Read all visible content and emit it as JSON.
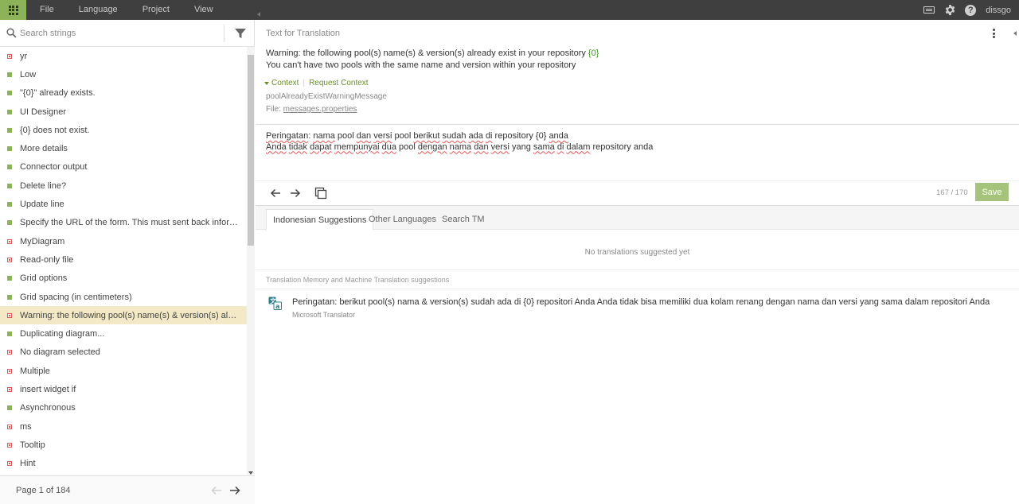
{
  "topbar": {
    "menu": [
      "File",
      "Language",
      "Project",
      "View"
    ],
    "user": "dissgo"
  },
  "search": {
    "placeholder": "Search strings"
  },
  "list": [
    {
      "text": "yr",
      "status": "red"
    },
    {
      "text": "Low",
      "status": "green"
    },
    {
      "text": "\"{0}\" already exists.",
      "status": "green"
    },
    {
      "text": "UI Designer",
      "status": "green"
    },
    {
      "text": "{0} does not exist.",
      "status": "green"
    },
    {
      "text": "More details",
      "status": "green"
    },
    {
      "text": "Connector output",
      "status": "green"
    },
    {
      "text": "Delete line?",
      "status": "green"
    },
    {
      "text": "Update line",
      "status": "green"
    },
    {
      "text": "Specify the URL of the form. This must sent back information that ...",
      "status": "green"
    },
    {
      "text": "MyDiagram",
      "status": "red"
    },
    {
      "text": "Read-only file",
      "status": "red"
    },
    {
      "text": "Grid options",
      "status": "green"
    },
    {
      "text": "Grid spacing (in centimeters)",
      "status": "green"
    },
    {
      "text": "Warning: the following pool(s) name(s) & version(s) already exist in...",
      "status": "red",
      "selected": true
    },
    {
      "text": "Duplicating diagram...",
      "status": "green"
    },
    {
      "text": "No diagram selected",
      "status": "red"
    },
    {
      "text": "Multiple",
      "status": "red"
    },
    {
      "text": "insert widget if",
      "status": "red"
    },
    {
      "text": "Asynchronous",
      "status": "green"
    },
    {
      "text": "ms",
      "status": "red"
    },
    {
      "text": "Tooltip",
      "status": "red"
    },
    {
      "text": "Hint",
      "status": "red"
    }
  ],
  "pager": {
    "label": "Page 1 of 184"
  },
  "source": {
    "header": "Text for Translation",
    "line1_prefix": "Warning: the following pool(s) name(s) & version(s) already exist in your repository ",
    "line1_placeholder": "{0}",
    "line2": "You can't have two pools with the same name and version within your repository"
  },
  "context": {
    "toggle": "Context",
    "request": "Request Context",
    "key": "poolAlreadyExistWarningMessage",
    "file_label": "File: ",
    "file_name": "messages.properties"
  },
  "target": {
    "line1": [
      {
        "t": "Peringatan",
        "sp": true
      },
      {
        "t": ": ",
        "sp": false
      },
      {
        "t": "nama",
        "sp": true
      },
      {
        "t": " pool ",
        "sp": false
      },
      {
        "t": "dan",
        "sp": true
      },
      {
        "t": " ",
        "sp": false
      },
      {
        "t": "versi",
        "sp": true
      },
      {
        "t": " pool ",
        "sp": false
      },
      {
        "t": "berikut",
        "sp": true
      },
      {
        "t": " ",
        "sp": false
      },
      {
        "t": "sudah",
        "sp": true
      },
      {
        "t": " ",
        "sp": false
      },
      {
        "t": "ada",
        "sp": true
      },
      {
        "t": " ",
        "sp": false
      },
      {
        "t": "di",
        "sp": true
      },
      {
        "t": " repository {0} ",
        "sp": false
      },
      {
        "t": "anda",
        "sp": true
      }
    ],
    "line2": [
      {
        "t": "Anda",
        "sp": true
      },
      {
        "t": " ",
        "sp": false
      },
      {
        "t": "tidak",
        "sp": true
      },
      {
        "t": " ",
        "sp": false
      },
      {
        "t": "dapat",
        "sp": true
      },
      {
        "t": " ",
        "sp": false
      },
      {
        "t": "mempunyai",
        "sp": true
      },
      {
        "t": " ",
        "sp": false
      },
      {
        "t": "dua",
        "sp": true
      },
      {
        "t": " pool ",
        "sp": false
      },
      {
        "t": "dengan",
        "sp": true
      },
      {
        "t": " ",
        "sp": false
      },
      {
        "t": "nama",
        "sp": true
      },
      {
        "t": " ",
        "sp": false
      },
      {
        "t": "dan",
        "sp": true
      },
      {
        "t": " ",
        "sp": false
      },
      {
        "t": "versi",
        "sp": true
      },
      {
        "t": " yang ",
        "sp": false
      },
      {
        "t": "sama",
        "sp": true
      },
      {
        "t": " ",
        "sp": false
      },
      {
        "t": "di",
        "sp": true
      },
      {
        "t": " ",
        "sp": false
      },
      {
        "t": "dalam",
        "sp": true
      },
      {
        "t": " repository anda",
        "sp": false
      }
    ]
  },
  "editor": {
    "counter": "167 / 170",
    "save_label": "Save"
  },
  "tabs": [
    "Indonesian Suggestions",
    "Other Languages",
    "Search TM"
  ],
  "suggestions": {
    "empty": "No translations suggested yet",
    "tm_header": "Translation Memory and Machine Translation suggestions",
    "mt_text": "Peringatan: berikut pool(s) nama & version(s) sudah ada di {0} repositori Anda Anda tidak bisa memiliki dua kolam renang dengan nama dan versi yang sama dalam repositori Anda",
    "mt_source": "Microsoft Translator"
  },
  "colors": {
    "accent": "#8cb25a",
    "topbar": "#3f3f3f",
    "selected_row": "#f3e9c6",
    "untranslated": "#e25555"
  }
}
